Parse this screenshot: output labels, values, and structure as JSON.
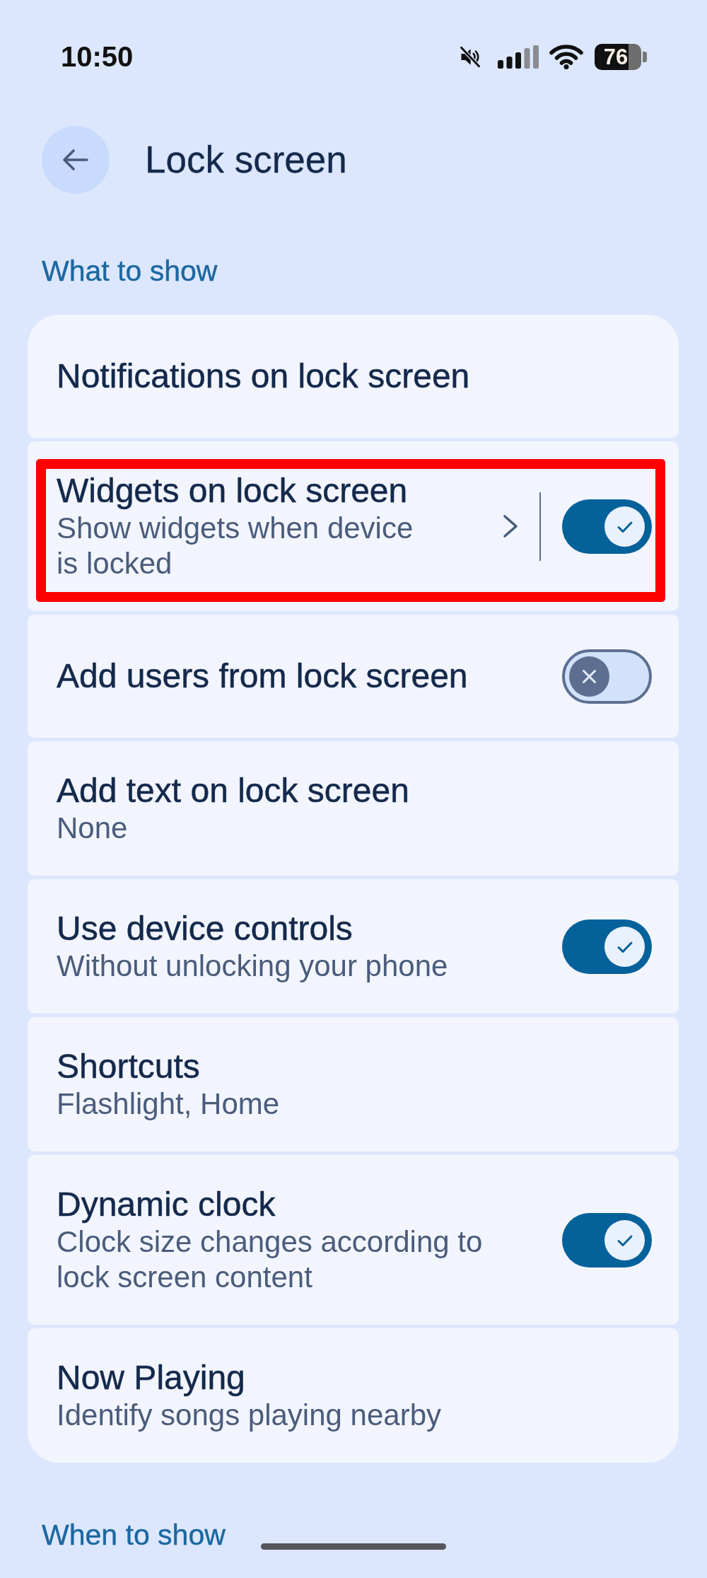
{
  "status_bar": {
    "time": "10:50",
    "battery": "76"
  },
  "header": {
    "title": "Lock screen"
  },
  "sections": [
    {
      "title": "What to show",
      "items": [
        {
          "kind": "plain",
          "title": "Notifications on lock screen",
          "highlighted": false
        },
        {
          "kind": "split",
          "title": "Widgets on lock screen",
          "subtitle": "Show widgets when device is locked",
          "on": true,
          "highlighted": true
        },
        {
          "kind": "switch",
          "title": "Add users from lock screen",
          "on": false,
          "highlighted": false
        },
        {
          "kind": "plain",
          "title": "Add text on lock screen",
          "subtitle": "None",
          "highlighted": false
        },
        {
          "kind": "switch",
          "title": "Use device controls",
          "subtitle": "Without unlocking your phone",
          "on": true,
          "highlighted": false
        },
        {
          "kind": "plain",
          "title": "Shortcuts",
          "subtitle": "Flashlight, Home",
          "highlighted": false
        },
        {
          "kind": "switch",
          "title": "Dynamic clock",
          "subtitle": "Clock size changes according to lock screen content",
          "on": true,
          "highlighted": false
        },
        {
          "kind": "plain",
          "title": "Now Playing",
          "subtitle": "Identify songs playing nearby",
          "highlighted": false
        }
      ]
    },
    {
      "title": "When to show"
    }
  ]
}
